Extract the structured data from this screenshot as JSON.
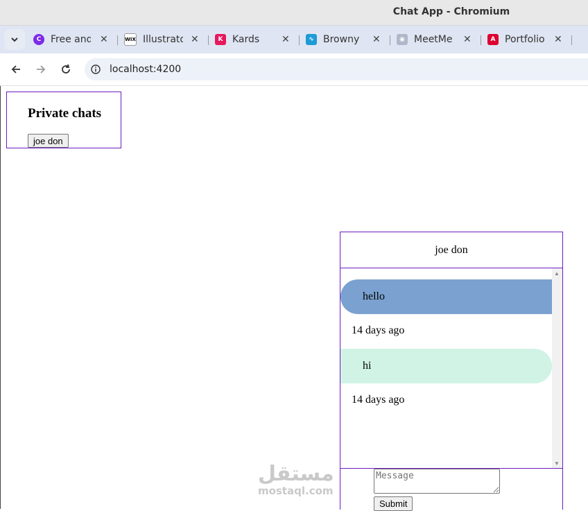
{
  "window": {
    "title": "Chat App - Chromium"
  },
  "tabs": [
    {
      "label": "Free and",
      "icon": "canva-icon",
      "color": "#7d2ae8"
    },
    {
      "label": "Illustrato",
      "icon": "wix-icon",
      "color": "#000000"
    },
    {
      "label": "Kards",
      "icon": "kards-icon",
      "color": "#e8175d"
    },
    {
      "label": "Browny",
      "icon": "browny-icon",
      "color": "#1d9bd7"
    },
    {
      "label": "MeetMe",
      "icon": "camera-icon",
      "color": "#b0b7c8"
    },
    {
      "label": "Portfolio",
      "icon": "angular-icon",
      "color": "#dd0031"
    }
  ],
  "address_bar": {
    "url": "localhost:4200"
  },
  "sidebar": {
    "heading": "Private chats",
    "contacts": [
      "joe don"
    ]
  },
  "chat": {
    "header": "joe don",
    "messages": [
      {
        "text": "hello",
        "time": "14 days ago",
        "type": "sent",
        "color": "#7aa1cf"
      },
      {
        "text": "hi",
        "time": "14 days ago",
        "type": "received",
        "color": "#d0f3e6"
      }
    ],
    "input_placeholder": "Message",
    "submit_label": "Submit"
  },
  "watermark": {
    "arabic": "مستقل",
    "latin": "mostaql.com"
  },
  "colors": {
    "accent_border": "#6a1bbf"
  }
}
